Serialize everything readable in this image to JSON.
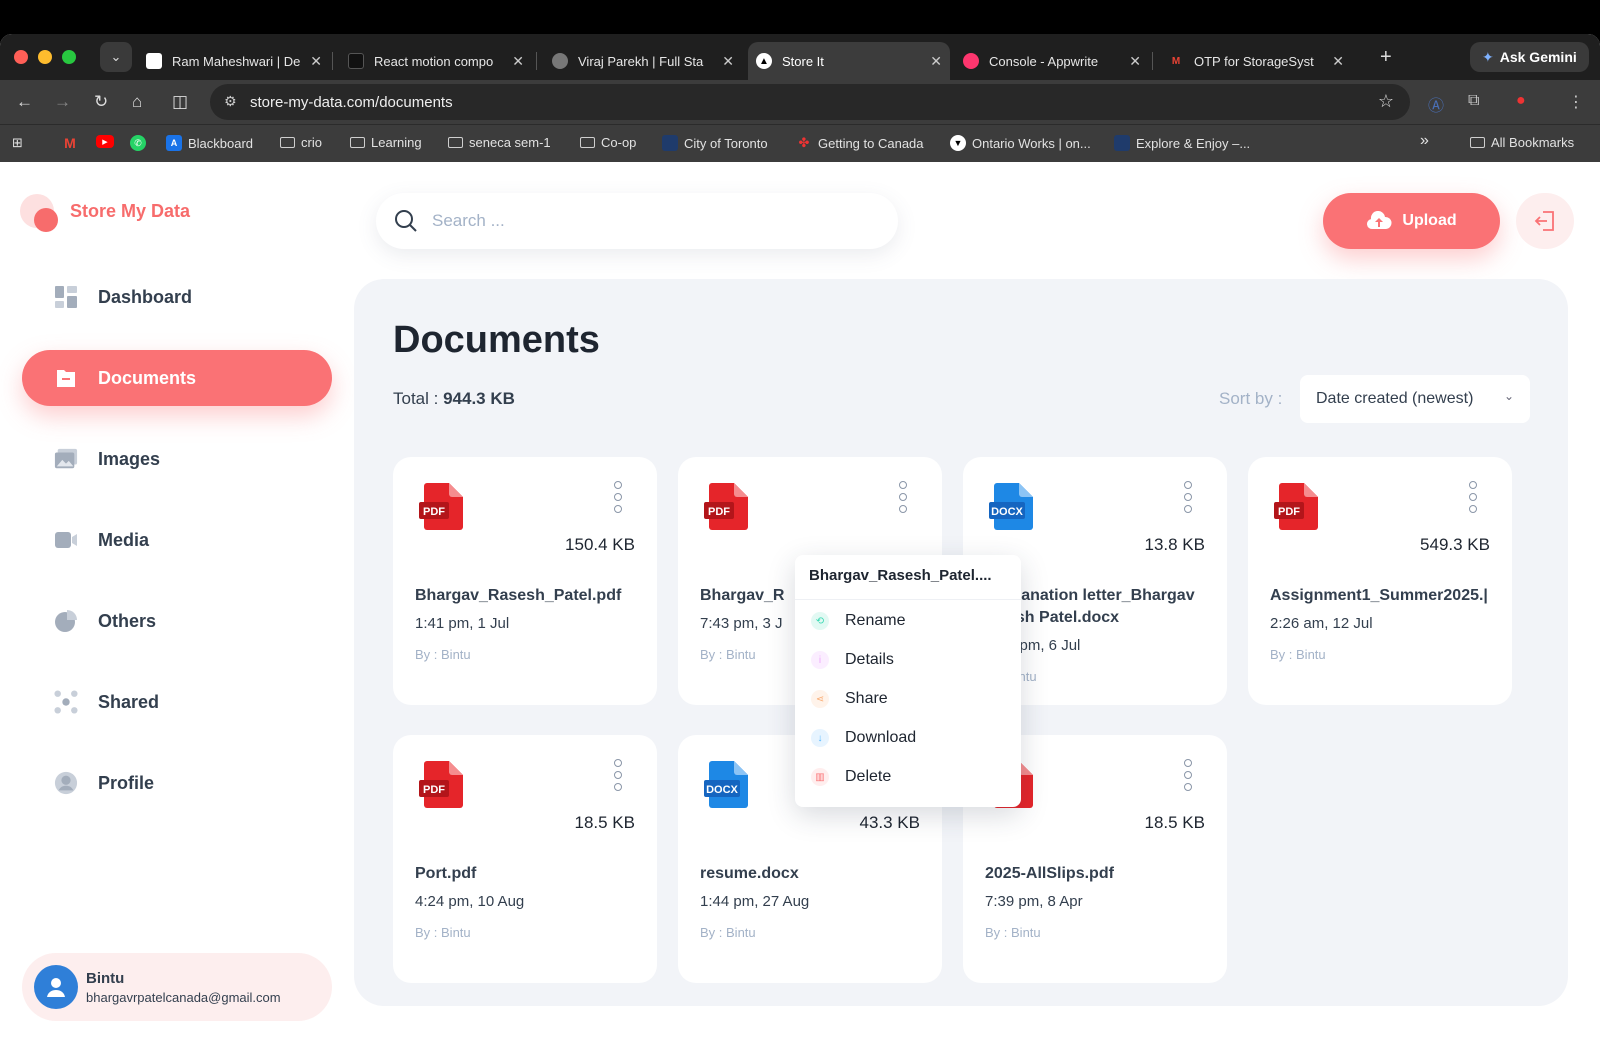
{
  "browser": {
    "tabs": [
      {
        "title": "Ram Maheshwari | De",
        "fav_color": "#ffffff",
        "fav_text": "",
        "active": false
      },
      {
        "title": "React motion compo",
        "fav_color": "#111111",
        "fav_text": "",
        "active": false
      },
      {
        "title": "Viraj Parekh | Full Sta",
        "fav_color": "#777777",
        "fav_text": "",
        "active": false
      },
      {
        "title": "Store It",
        "fav_color": "#000000",
        "fav_text": "▲",
        "active": true
      },
      {
        "title": "Console - Appwrite",
        "fav_color": "#fd366e",
        "fav_text": "",
        "active": false
      },
      {
        "title": "OTP for StorageSyst",
        "fav_color": "#ea4335",
        "fav_text": "M",
        "active": false
      }
    ],
    "gemini_label": "Ask Gemini",
    "url": "store-my-data.com/documents",
    "bookmarks": [
      {
        "label": "Blackboard",
        "type": "site"
      },
      {
        "label": "crio",
        "type": "folder"
      },
      {
        "label": "Learning",
        "type": "folder"
      },
      {
        "label": "seneca sem-1",
        "type": "folder"
      },
      {
        "label": "Co-op",
        "type": "folder"
      },
      {
        "label": "City of Toronto",
        "type": "site"
      },
      {
        "label": "Getting to Canada",
        "type": "site"
      },
      {
        "label": "Ontario Works | on...",
        "type": "site"
      },
      {
        "label": "Explore & Enjoy –...",
        "type": "site"
      }
    ],
    "overflow_label": "»",
    "all_bookmarks": "All Bookmarks"
  },
  "app": {
    "brand": "Store My Data",
    "search_placeholder": "Search ...",
    "upload_label": "Upload",
    "nav": [
      {
        "label": "Dashboard",
        "icon": "dashboard-icon",
        "active": false
      },
      {
        "label": "Documents",
        "icon": "documents-icon",
        "active": true
      },
      {
        "label": "Images",
        "icon": "images-icon",
        "active": false
      },
      {
        "label": "Media",
        "icon": "media-icon",
        "active": false
      },
      {
        "label": "Others",
        "icon": "others-icon",
        "active": false
      },
      {
        "label": "Shared",
        "icon": "shared-icon",
        "active": false
      },
      {
        "label": "Profile",
        "icon": "profile-icon",
        "active": false
      }
    ],
    "user": {
      "name": "Bintu",
      "email": "bhargavrpatelcanada@gmail.com"
    },
    "page_title": "Documents",
    "total_label": "Total :",
    "total_value": "944.3 KB",
    "sort_label": "Sort by :",
    "sort_value": "Date created (newest)",
    "files": [
      {
        "type": "PDF",
        "size": "150.4 KB",
        "name": "Bhargav_Rasesh_Patel.pdf",
        "date": "1:41 pm, 1 Jul",
        "by": "By : Bintu"
      },
      {
        "type": "PDF",
        "size": "",
        "name": "Bhargav_R",
        "date": "7:43 pm, 3 J",
        "by": "By : Bintu"
      },
      {
        "type": "DOCX",
        "size": "13.8 KB",
        "name": "planation letter_Bhargav",
        "name2": "esh Patel.docx",
        "date": "3 pm, 6 Jul",
        "by": "Bintu"
      },
      {
        "type": "PDF",
        "size": "549.3 KB",
        "name": "Assignment1_Summer2025.|",
        "date": "2:26 am, 12 Jul",
        "by": "By : Bintu"
      },
      {
        "type": "PDF",
        "size": "18.5 KB",
        "name": "Port.pdf",
        "date": "4:24 pm, 10 Aug",
        "by": "By : Bintu"
      },
      {
        "type": "DOCX",
        "size": "43.3 KB",
        "name": "resume.docx",
        "date": "1:44 pm, 27 Aug",
        "by": "By : Bintu"
      },
      {
        "type": "PDF",
        "size": "18.5 KB",
        "name": "2025-AllSlips.pdf",
        "date": "7:39 pm, 8 Apr",
        "by": "By : Bintu"
      }
    ],
    "context_menu": {
      "title": "Bhargav_Rasesh_Patel....",
      "items": [
        {
          "label": "Rename",
          "color": "#3dd9b3"
        },
        {
          "label": "Details",
          "color": "#eea8fd"
        },
        {
          "label": "Share",
          "color": "#f9ab72"
        },
        {
          "label": "Download",
          "color": "#56b8ff"
        },
        {
          "label": "Delete",
          "color": "#fa7275"
        }
      ]
    }
  },
  "colors": {
    "brand": "#fa7275",
    "pdf": "#e5252a",
    "docx": "#1e88e5"
  }
}
